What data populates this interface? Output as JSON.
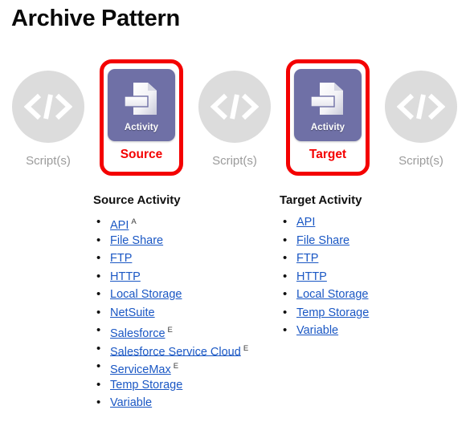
{
  "page": {
    "title": "Archive Pattern"
  },
  "diagram": {
    "nodes": [
      {
        "kind": "script",
        "label": "Script(s)",
        "icon": "code-brackets-icon",
        "highlighted": false
      },
      {
        "kind": "activity",
        "tile_text": "Activity",
        "label": "Source",
        "icon": "document-activity-icon",
        "highlighted": true
      },
      {
        "kind": "script",
        "label": "Script(s)",
        "icon": "code-brackets-icon",
        "highlighted": false
      },
      {
        "kind": "activity",
        "tile_text": "Activity",
        "label": "Target",
        "icon": "document-activity-icon",
        "highlighted": true
      },
      {
        "kind": "script",
        "label": "Script(s)",
        "icon": "code-brackets-icon",
        "highlighted": false
      }
    ]
  },
  "lists": {
    "source": {
      "heading": "Source Activity",
      "items": [
        {
          "label": "API",
          "marker": "A"
        },
        {
          "label": "File Share",
          "marker": ""
        },
        {
          "label": "FTP",
          "marker": ""
        },
        {
          "label": "HTTP",
          "marker": ""
        },
        {
          "label": "Local Storage",
          "marker": ""
        },
        {
          "label": "NetSuite",
          "marker": ""
        },
        {
          "label": "Salesforce",
          "marker": "E"
        },
        {
          "label": "Salesforce Service Cloud",
          "marker": "E"
        },
        {
          "label": "ServiceMax",
          "marker": "E"
        },
        {
          "label": "Temp Storage",
          "marker": ""
        },
        {
          "label": "Variable",
          "marker": ""
        }
      ]
    },
    "target": {
      "heading": "Target Activity",
      "items": [
        {
          "label": "API",
          "marker": ""
        },
        {
          "label": "File Share",
          "marker": ""
        },
        {
          "label": "FTP",
          "marker": ""
        },
        {
          "label": "HTTP",
          "marker": ""
        },
        {
          "label": "Local Storage",
          "marker": ""
        },
        {
          "label": "Temp Storage",
          "marker": ""
        },
        {
          "label": "Variable",
          "marker": ""
        }
      ]
    }
  },
  "colors": {
    "title": "#0a0a0a",
    "highlight_red": "#f40000",
    "activity_purple": "#6f70a6",
    "script_gray": "#dcdcdc",
    "script_label_gray": "#9b9b9b",
    "link_blue": "#1a57c4"
  }
}
